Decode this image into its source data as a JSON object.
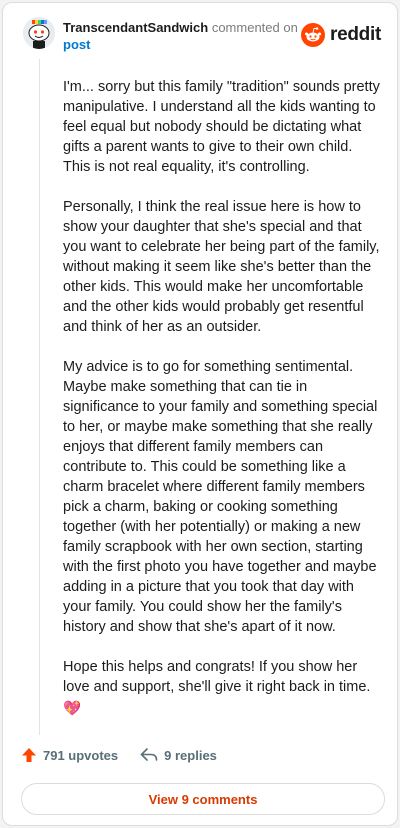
{
  "header": {
    "username": "TranscendantSandwich",
    "action": "commented on",
    "post_link": "post",
    "logo_text": "reddit"
  },
  "comment": {
    "paragraphs": [
      "I'm... sorry but this family \"tradition\" sounds pretty manipulative. I understand all the kids wanting to feel equal but nobody should be dictating what gifts a parent wants to give to their own child. This is not real equality, it's controlling.",
      "Personally, I think the real issue here is how to show your daughter that she's special and that you want to celebrate her being part of the family, without making it seem like she's better than the other kids. This would make her uncomfortable and the other kids would probably get resentful and think of her as an outsider.",
      "My advice is to go for something sentimental. Maybe make something that can tie in significance to your family and something special to her, or maybe make something that she really enjoys that different family members can contribute to. This could be something like a charm bracelet where different family members pick a charm, baking or cooking something together (with her potentially) or making a new family scrapbook with her own section, starting with the first photo you have together and maybe adding in a picture that you took that day with your family. You could show her the family's history and show that she's apart of it now.",
      "Hope this helps and congrats! If you show her love and support, she'll give it right back in time."
    ],
    "emoji": "💖"
  },
  "footer": {
    "upvotes": "791 upvotes",
    "replies": "9 replies",
    "view_comments": "View 9 comments"
  },
  "colors": {
    "upvote": "#ff4500",
    "link": "#0079d3",
    "view_button": "#d93a00"
  },
  "icons": {
    "upvote": "arrow-up-icon",
    "reply": "reply-arrow-icon",
    "logo": "reddit-snoo-icon",
    "avatar": "snoo-avatar-icon"
  }
}
